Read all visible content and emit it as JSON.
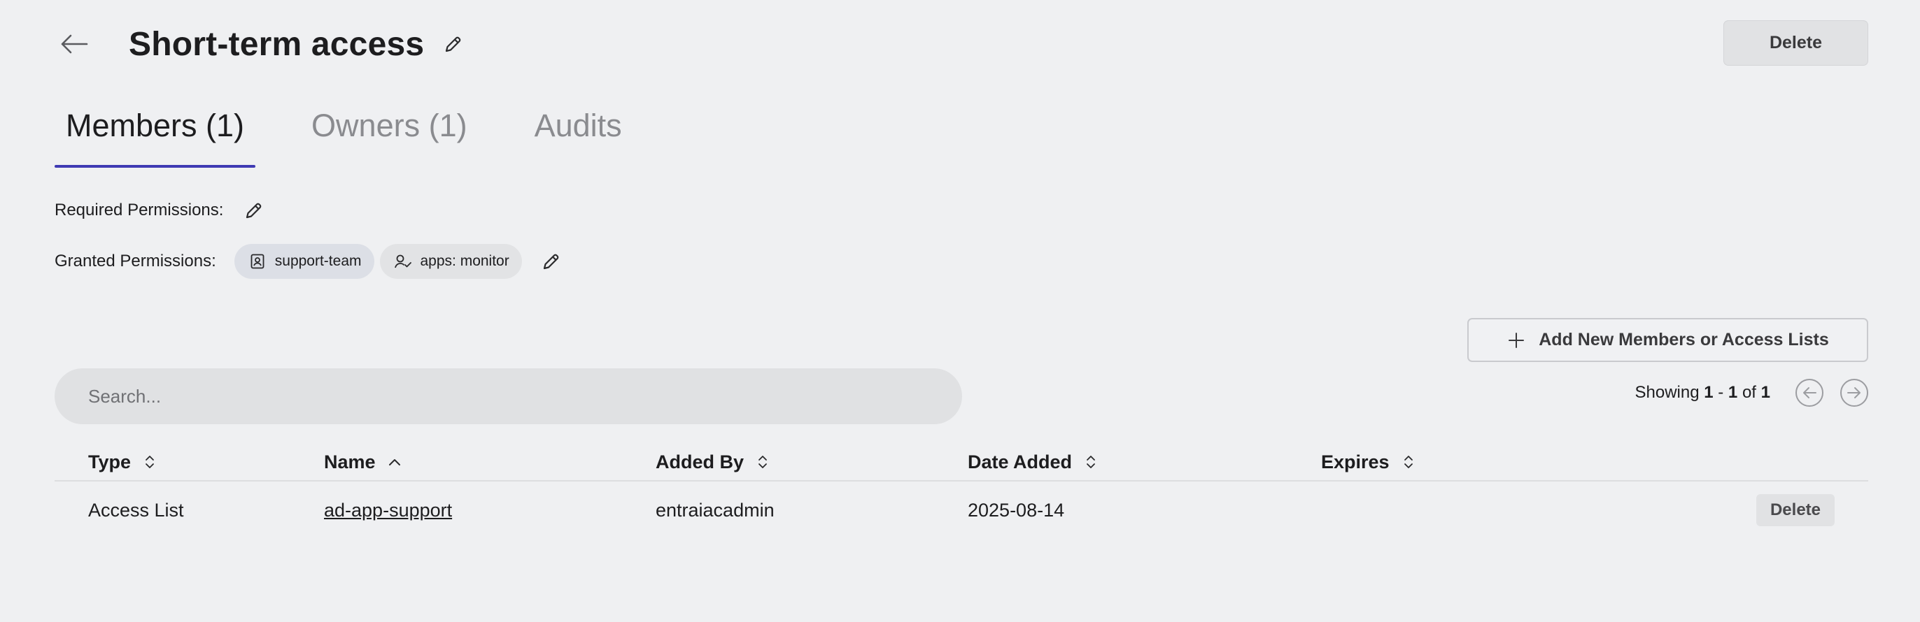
{
  "header": {
    "title": "Short-term access",
    "delete_label": "Delete"
  },
  "tabs": [
    {
      "label": "Members (1)",
      "active": true
    },
    {
      "label": "Owners (1)",
      "active": false
    },
    {
      "label": "Audits",
      "active": false
    }
  ],
  "permissions": {
    "required_label": "Required Permissions:",
    "granted_label": "Granted Permissions:",
    "granted": [
      {
        "label": "support-team",
        "icon": "group-badge-icon"
      },
      {
        "label": "apps: monitor",
        "icon": "user-check-icon"
      }
    ]
  },
  "add_button": {
    "label": "Add New Members or Access Lists"
  },
  "search": {
    "placeholder": "Search...",
    "value": ""
  },
  "pagination": {
    "prefix": "Showing",
    "start": "1",
    "separator": "-",
    "end": "1",
    "of": "of",
    "total": "1"
  },
  "table": {
    "columns": [
      "Type",
      "Name",
      "Added By",
      "Date Added",
      "Expires"
    ],
    "rows": [
      {
        "type": "Access List",
        "name": "ad-app-support",
        "added_by": "entraiacadmin",
        "date_added": "2025-08-14",
        "expires": "",
        "action": "Delete"
      }
    ]
  },
  "colors": {
    "background": "#eff0f2",
    "accent": "#3f3ab3",
    "chip_group": "#dcdfe6",
    "chip_role": "#e2e3e5"
  }
}
